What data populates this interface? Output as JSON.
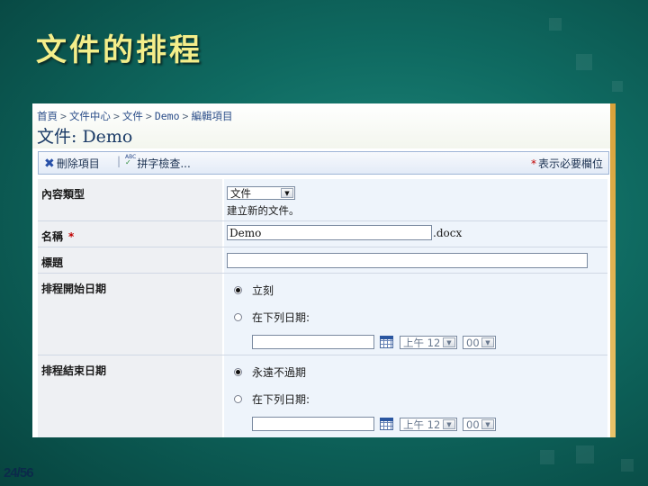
{
  "slide": {
    "title": "文件的排程",
    "page_number": "24/56"
  },
  "breadcrumb": {
    "items": [
      "首頁",
      "文件中心",
      "文件",
      "Demo",
      "編輯項目"
    ],
    "separator": ">"
  },
  "page_heading": "文件: Demo",
  "toolbar": {
    "delete_label": "刪除項目",
    "divider": "|",
    "spell_icon_text": "ABC",
    "spell_label": "拼字檢查...",
    "required_star": "*",
    "required_note": "表示必要欄位"
  },
  "form": {
    "content_type": {
      "label": "內容類型",
      "selected": "文件",
      "hint": "建立新的文件。"
    },
    "name": {
      "label": "名稱",
      "required_star": "*",
      "value": "Demo",
      "suffix": ".docx"
    },
    "title_field": {
      "label": "標題",
      "value": ""
    },
    "schedule_start": {
      "label": "排程開始日期",
      "option_now": "立刻",
      "option_date": "在下列日期:",
      "selected": "now",
      "date_value": "",
      "hour": "上午 12",
      "minute": "00"
    },
    "schedule_end": {
      "label": "排程結束日期",
      "option_never": "永遠不過期",
      "option_date": "在下列日期:",
      "selected": "never",
      "date_value": "",
      "hour": "上午 12",
      "minute": "00"
    }
  },
  "icons": {
    "dropdown_arrow": "▼",
    "delete_icon_glyph": "✖"
  },
  "colors": {
    "title_yellow": "#f4ee8a",
    "link_blue": "#2d4f8a",
    "required_red": "#c00000",
    "accent_orange": "#d8a23a"
  }
}
